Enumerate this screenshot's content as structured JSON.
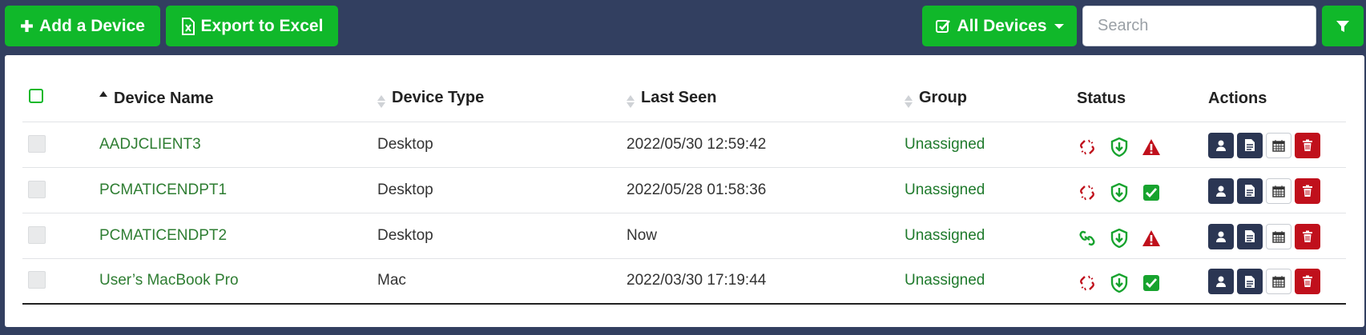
{
  "toolbar": {
    "add_label": "Add a Device",
    "export_label": "Export to Excel",
    "filter_menu_label": "All Devices",
    "search_placeholder": "Search"
  },
  "table": {
    "headers": {
      "name": "Device Name",
      "type": "Device Type",
      "seen": "Last Seen",
      "group": "Group",
      "status": "Status",
      "actions": "Actions"
    },
    "sort_column": "Device Name",
    "rows": [
      {
        "name": "AADJCLIENT3",
        "type": "Desktop",
        "seen": "2022/05/30 12:59:42",
        "group": "Unassigned",
        "connection": "disconnected",
        "protection": "protected",
        "alert": "warning"
      },
      {
        "name": "PCMATICENDPT1",
        "type": "Desktop",
        "seen": "2022/05/28 01:58:36",
        "group": "Unassigned",
        "connection": "disconnected",
        "protection": "protected",
        "alert": "ok"
      },
      {
        "name": "PCMATICENDPT2",
        "type": "Desktop",
        "seen": "Now",
        "group": "Unassigned",
        "connection": "connected",
        "protection": "protected",
        "alert": "warning"
      },
      {
        "name": "User’s MacBook Pro",
        "type": "Mac",
        "seen": "2022/03/30 17:19:44",
        "group": "Unassigned",
        "connection": "disconnected",
        "protection": "protected",
        "alert": "ok"
      }
    ]
  },
  "icons": {
    "add": "plus-icon",
    "export": "excel-file-icon",
    "devices": "checkbox-icon",
    "filter": "funnel-icon",
    "actions": [
      "user-icon",
      "document-icon",
      "calendar-icon",
      "trash-icon"
    ]
  },
  "colors": {
    "background": "#323f60",
    "accent_green": "#10b82a",
    "link_green": "#2e7d32",
    "danger_red": "#c0101c",
    "action_dark": "#2b3653"
  }
}
